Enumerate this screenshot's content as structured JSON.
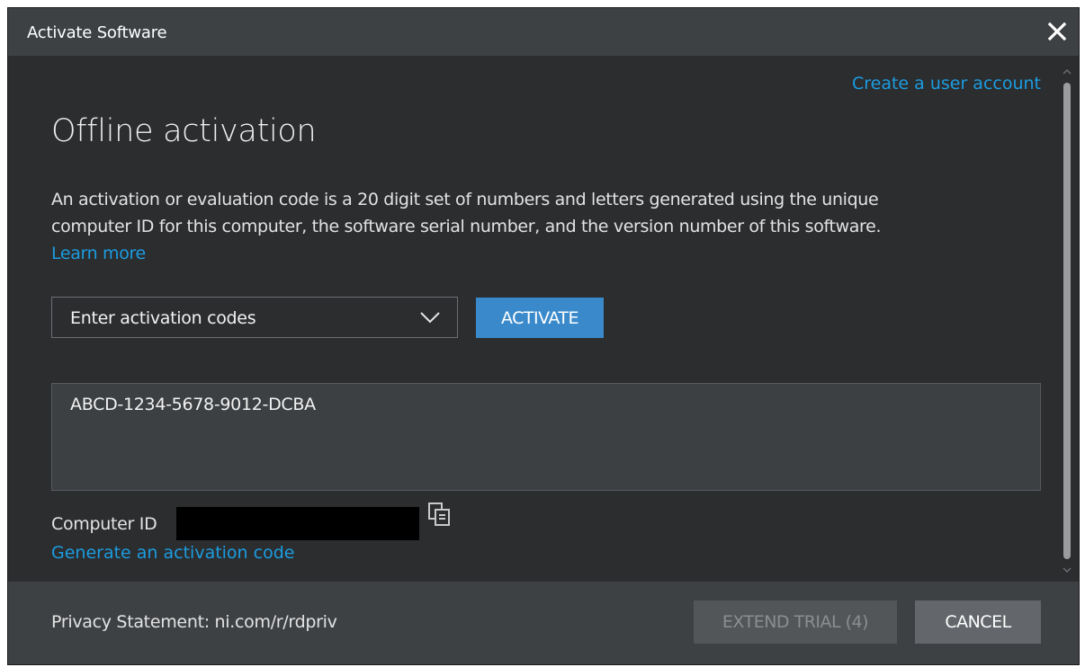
{
  "window": {
    "title": "Activate Software",
    "close_icon": "close-icon"
  },
  "header": {
    "create_account_link": "Create a user account"
  },
  "main": {
    "heading": "Offline activation",
    "description_line1": "An activation or evaluation code is a 20 digit set of numbers and letters generated using the unique",
    "description_line2": "computer ID for this computer, the software serial number, and the version number of this software.",
    "learn_more_link": "Learn more",
    "dropdown": {
      "selected": "Enter activation codes",
      "icon": "chevron-down-icon"
    },
    "activate_button": "ACTIVATE",
    "codes_value": "ABCD-1234-5678-9012-DCBA",
    "computer_id_label": "Computer ID",
    "copy_icon": "copy-icon",
    "generate_link": "Generate an activation code"
  },
  "footer": {
    "privacy_statement": "Privacy Statement: ni.com/r/rdpriv",
    "extend_trial_button": "EXTEND TRIAL (4)",
    "cancel_button": "CANCEL"
  },
  "colors": {
    "link": "#1c9ce0",
    "accent_button": "#3a8acb",
    "background": "#2b2d2f",
    "titlebar": "#3e4144"
  }
}
